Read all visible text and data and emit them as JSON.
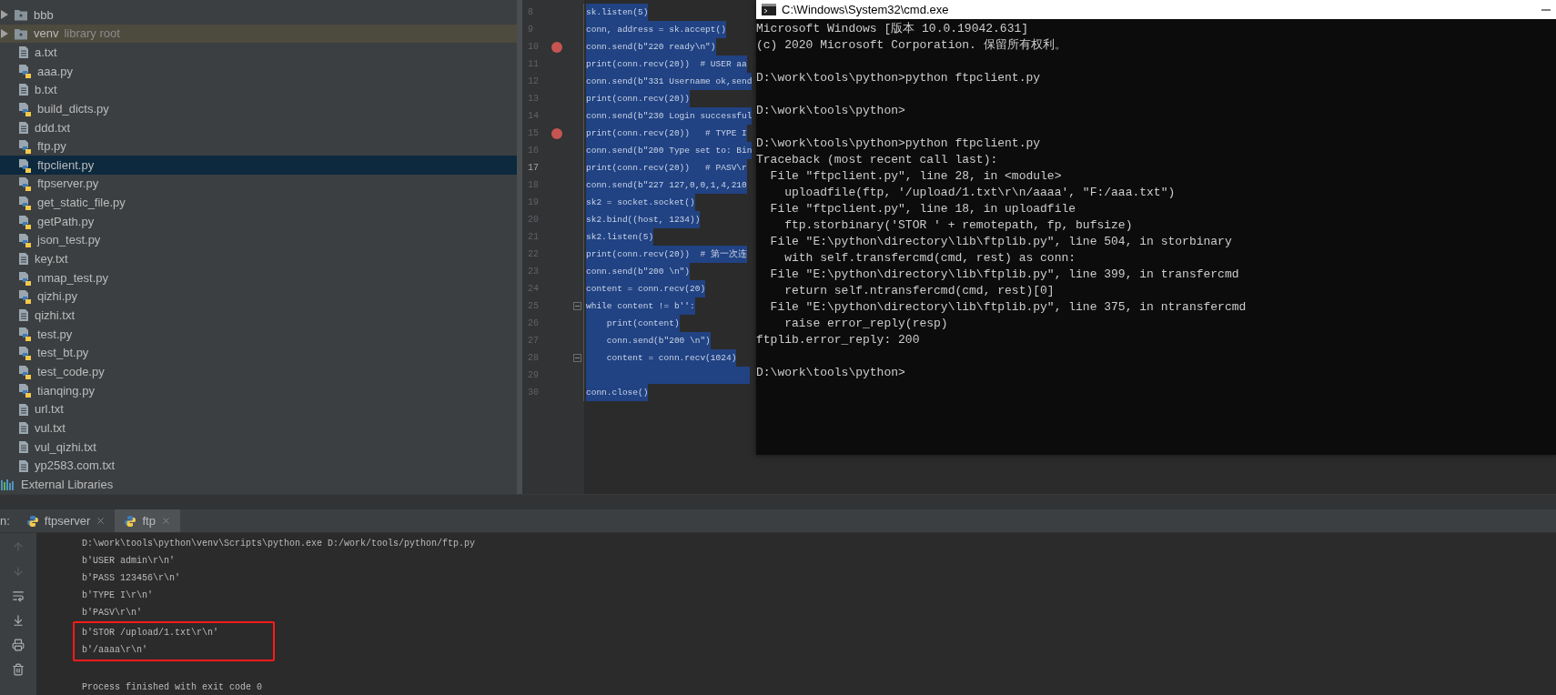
{
  "project_tree": {
    "items": [
      {
        "kind": "folder",
        "label": "bbb",
        "expanded": false,
        "selected": false
      },
      {
        "kind": "folder",
        "label": "venv",
        "hint": "library root",
        "expanded": false,
        "selected": false
      },
      {
        "kind": "txt",
        "label": "a.txt",
        "selected": false
      },
      {
        "kind": "py",
        "label": "aaa.py",
        "selected": false
      },
      {
        "kind": "txt",
        "label": "b.txt",
        "selected": false
      },
      {
        "kind": "py",
        "label": "build_dicts.py",
        "selected": false
      },
      {
        "kind": "txt",
        "label": "ddd.txt",
        "selected": false
      },
      {
        "kind": "py",
        "label": "ftp.py",
        "selected": false
      },
      {
        "kind": "py",
        "label": "ftpclient.py",
        "selected": true
      },
      {
        "kind": "py",
        "label": "ftpserver.py",
        "selected": false
      },
      {
        "kind": "py",
        "label": "get_static_file.py",
        "selected": false
      },
      {
        "kind": "py",
        "label": "getPath.py",
        "selected": false
      },
      {
        "kind": "py",
        "label": "json_test.py",
        "selected": false
      },
      {
        "kind": "txt",
        "label": "key.txt",
        "selected": false
      },
      {
        "kind": "py",
        "label": "nmap_test.py",
        "selected": false
      },
      {
        "kind": "py",
        "label": "qizhi.py",
        "selected": false
      },
      {
        "kind": "txt",
        "label": "qizhi.txt",
        "selected": false
      },
      {
        "kind": "py",
        "label": "test.py",
        "selected": false
      },
      {
        "kind": "py",
        "label": "test_bt.py",
        "selected": false
      },
      {
        "kind": "py",
        "label": "test_code.py",
        "selected": false
      },
      {
        "kind": "py",
        "label": "tianqing.py",
        "selected": false
      },
      {
        "kind": "txt",
        "label": "url.txt",
        "selected": false
      },
      {
        "kind": "txt",
        "label": "vul.txt",
        "selected": false
      },
      {
        "kind": "txt",
        "label": "vul_qizhi.txt",
        "selected": false
      },
      {
        "kind": "txt",
        "label": "yp2583.com.txt",
        "selected": false
      },
      {
        "kind": "libraries",
        "label": "External Libraries",
        "selected": false
      }
    ]
  },
  "editor": {
    "lines": [
      {
        "number": "8",
        "code": "sk.listen(5)",
        "selected": true,
        "breakpoint": false,
        "fold": false,
        "current": false
      },
      {
        "number": "9",
        "code": "conn, address = sk.accept()",
        "selected": true,
        "breakpoint": false,
        "fold": false,
        "current": false
      },
      {
        "number": "10",
        "code": "conn.send(b\"220 ready\\n\")",
        "selected": true,
        "breakpoint": true,
        "fold": false,
        "current": false
      },
      {
        "number": "11",
        "code": "print(conn.recv(20))  # USER aa",
        "selected": true,
        "breakpoint": false,
        "fold": false,
        "current": false
      },
      {
        "number": "12",
        "code": "conn.send(b\"331 Username ok,send",
        "selected": true,
        "breakpoint": false,
        "fold": false,
        "current": false
      },
      {
        "number": "13",
        "code": "print(conn.recv(20))",
        "selected": true,
        "breakpoint": false,
        "fold": false,
        "current": false
      },
      {
        "number": "14",
        "code": "conn.send(b\"230 Login successful",
        "selected": true,
        "breakpoint": false,
        "fold": false,
        "current": false
      },
      {
        "number": "15",
        "code": "print(conn.recv(20))   # TYPE I",
        "selected": true,
        "breakpoint": true,
        "fold": false,
        "current": false
      },
      {
        "number": "16",
        "code": "conn.send(b\"200 Type set to: Bin",
        "selected": true,
        "breakpoint": false,
        "fold": false,
        "current": false
      },
      {
        "number": "17",
        "code": "print(conn.recv(20))   # PASV\\r",
        "selected": true,
        "breakpoint": false,
        "fold": false,
        "current": true
      },
      {
        "number": "18",
        "code": "conn.send(b\"227 127,0,0,1,4,210",
        "selected": true,
        "breakpoint": false,
        "fold": false,
        "current": false
      },
      {
        "number": "19",
        "code": "sk2 = socket.socket()",
        "selected": true,
        "breakpoint": false,
        "fold": false,
        "current": false
      },
      {
        "number": "20",
        "code": "sk2.bind((host, 1234))",
        "selected": true,
        "breakpoint": false,
        "fold": false,
        "current": false
      },
      {
        "number": "21",
        "code": "sk2.listen(5)",
        "selected": true,
        "breakpoint": false,
        "fold": false,
        "current": false
      },
      {
        "number": "22",
        "code": "print(conn.recv(20))  # 第一次连",
        "selected": true,
        "breakpoint": false,
        "fold": false,
        "current": false
      },
      {
        "number": "23",
        "code": "conn.send(b\"200 \\n\")",
        "selected": true,
        "breakpoint": false,
        "fold": false,
        "current": false
      },
      {
        "number": "24",
        "code": "content = conn.recv(20)",
        "selected": true,
        "breakpoint": false,
        "fold": false,
        "current": false
      },
      {
        "number": "25",
        "code": "while content != b'':",
        "selected": true,
        "breakpoint": false,
        "fold": true,
        "current": false
      },
      {
        "number": "26",
        "code": "    print(content)",
        "selected": true,
        "breakpoint": false,
        "fold": false,
        "current": false
      },
      {
        "number": "27",
        "code": "    conn.send(b\"200 \\n\")",
        "selected": true,
        "breakpoint": false,
        "fold": false,
        "current": false
      },
      {
        "number": "28",
        "code": "    content = conn.recv(1024)",
        "selected": true,
        "breakpoint": false,
        "fold": true,
        "current": false
      },
      {
        "number": "29",
        "selected": true,
        "breakpoint": false,
        "fold": false,
        "current": false
      },
      {
        "number": "30",
        "code": "conn.close()",
        "selected": true,
        "breakpoint": false,
        "fold": false,
        "current": false
      }
    ]
  },
  "cmd_window": {
    "title": "C:\\Windows\\System32\\cmd.exe",
    "lines": [
      {
        "kind": "text",
        "text": "Microsoft Windows [版本 10.0.19042.631]"
      },
      {
        "kind": "text",
        "text": "(c) 2020 Microsoft Corporation. 保留所有权利。"
      },
      {
        "kind": "blank"
      },
      {
        "kind": "text",
        "text": "D:\\work\\tools\\python>python ftpclient.py"
      },
      {
        "kind": "blank"
      },
      {
        "kind": "text",
        "text": "D:\\work\\tools\\python>"
      },
      {
        "kind": "blank"
      },
      {
        "kind": "text",
        "text": "D:\\work\\tools\\python>python ftpclient.py"
      },
      {
        "text": "Traceback (most recent call last):"
      },
      {
        "text": "  File \"ftpclient.py\", line 28, in <module>"
      },
      {
        "text": "    uploadfile(ftp, '/upload/1.txt\\r\\n/aaaa', \"F:/aaa.txt\")"
      },
      {
        "text": "  File \"ftpclient.py\", line 18, in uploadfile"
      },
      {
        "text": "    ftp.storbinary('STOR ' + remotepath, fp, bufsize)"
      },
      {
        "text": "  File \"E:\\python\\directory\\lib\\ftplib.py\", line 504, in storbinary"
      },
      {
        "text": "    with self.transfercmd(cmd, rest) as conn:"
      },
      {
        "text": "  File \"E:\\python\\directory\\lib\\ftplib.py\", line 399, in transfercmd"
      },
      {
        "text": "    return self.ntransfercmd(cmd, rest)[0]"
      },
      {
        "text": "  File \"E:\\python\\directory\\lib\\ftplib.py\", line 375, in ntransfercmd"
      },
      {
        "text": "    raise error_reply(resp)"
      },
      {
        "text": "ftplib.error_reply: 200"
      },
      {
        "kind": "blank"
      },
      {
        "kind": "text",
        "text": "D:\\work\\tools\\python>"
      }
    ]
  },
  "run_panel": {
    "label": "n:",
    "tabs": [
      {
        "label": "ftpserver",
        "selected": false
      },
      {
        "label": "ftp",
        "selected": true
      }
    ],
    "console": [
      {
        "text": "D:\\work\\tools\\python\\venv\\Scripts\\python.exe D:/work/tools/python/ftp.py",
        "boxed": false
      },
      {
        "text": "b'USER admin\\r\\n'",
        "boxed": false
      },
      {
        "text": "b'PASS 123456\\r\\n'",
        "boxed": false
      },
      {
        "text": "b'TYPE I\\r\\n'",
        "boxed": false
      },
      {
        "text": "b'PASV\\r\\n'",
        "boxed": false
      },
      {
        "text": "b'STOR /upload/1.txt\\r\\n'",
        "boxed": true
      },
      {
        "text": "b'/aaaa\\r\\n'",
        "boxed": true
      },
      {
        "boxed": false
      },
      {
        "text": "Process finished with exit code 0",
        "boxed": false
      }
    ]
  }
}
